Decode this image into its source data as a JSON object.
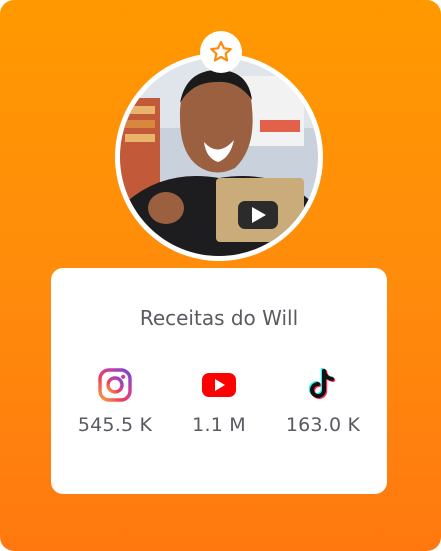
{
  "profile": {
    "name": "Receitas do Will",
    "badge_icon": "star-icon",
    "accent": "#ff8a0c"
  },
  "stats": [
    {
      "platform": "instagram",
      "icon": "instagram-icon",
      "value": "545.5 K"
    },
    {
      "platform": "youtube",
      "icon": "youtube-icon",
      "value": "1.1 M"
    },
    {
      "platform": "tiktok",
      "icon": "tiktok-icon",
      "value": "163.0 K"
    }
  ]
}
